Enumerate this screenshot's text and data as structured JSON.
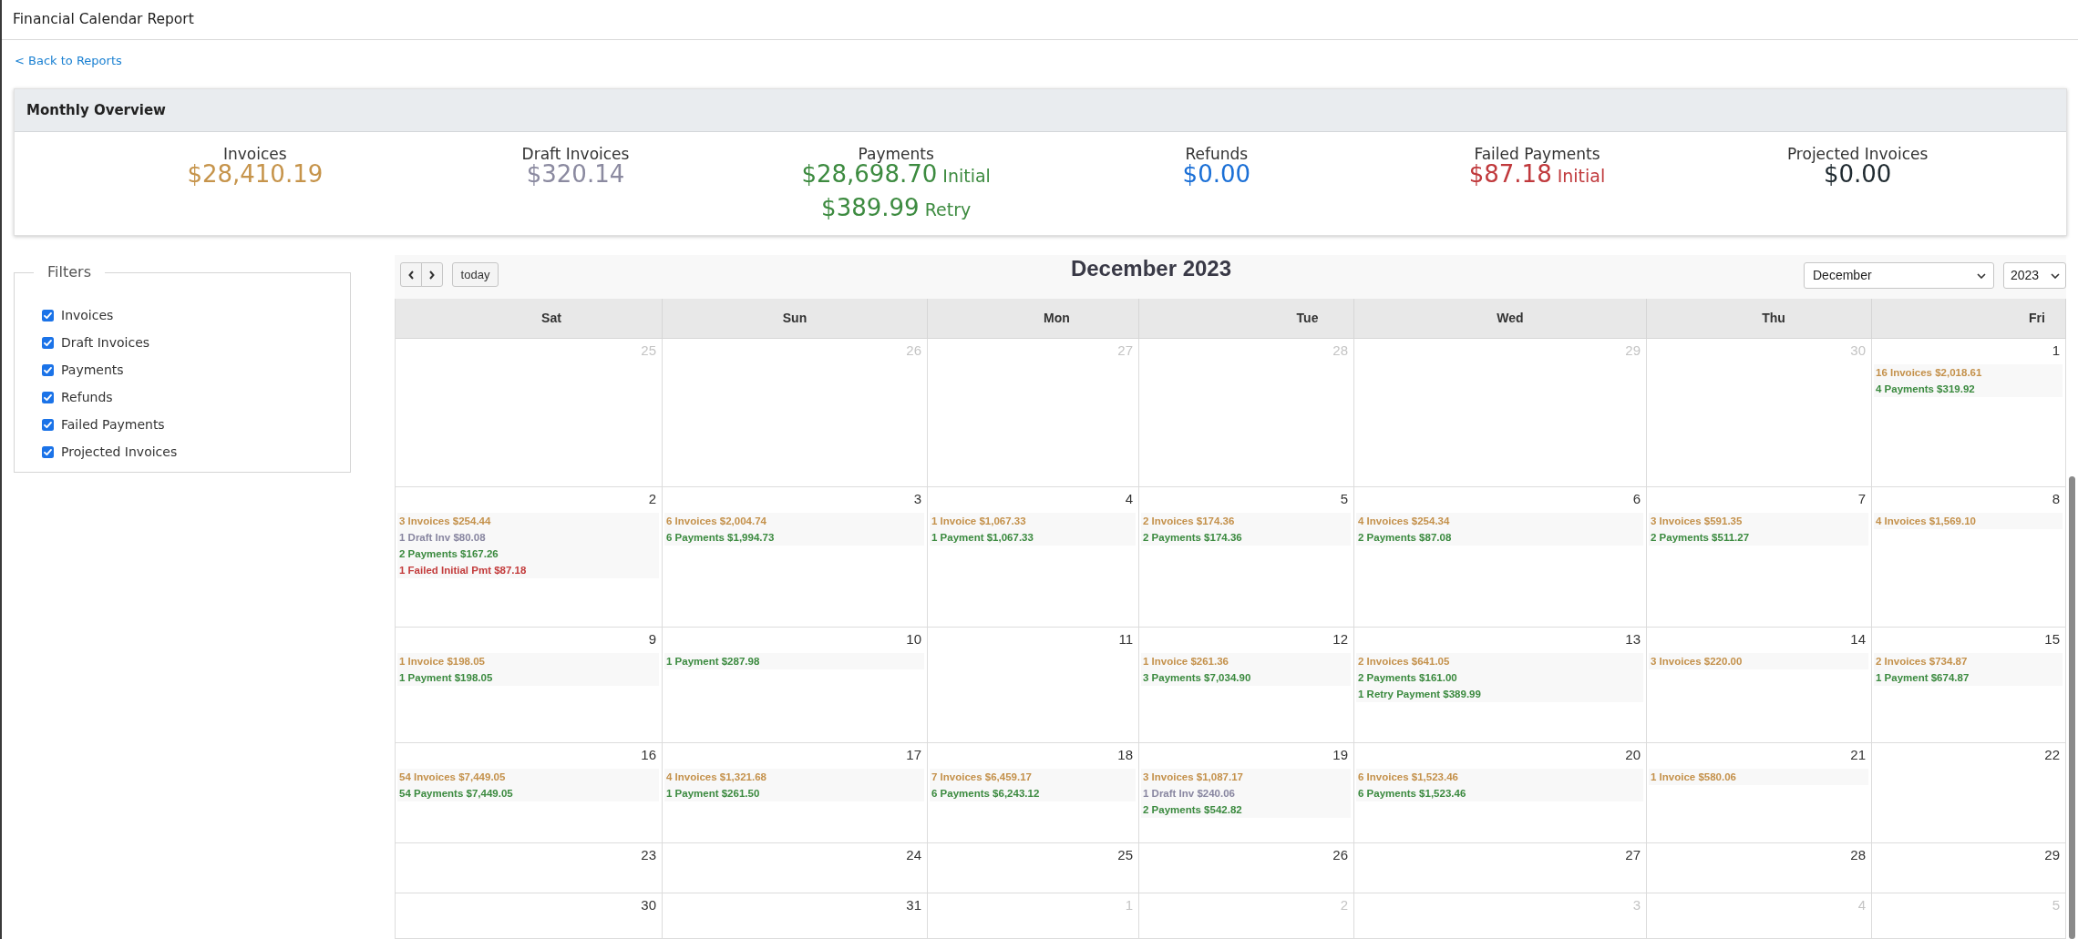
{
  "page": {
    "title": "Financial Calendar Report",
    "back_link": "< Back to Reports"
  },
  "overview": {
    "title": "Monthly Overview",
    "stats": [
      {
        "label": "Invoices",
        "color": "#c6944b",
        "amounts": [
          {
            "value": "$28,410.19"
          }
        ]
      },
      {
        "label": "Draft Invoices",
        "color": "#8b8aa0",
        "amounts": [
          {
            "value": "$320.14"
          }
        ]
      },
      {
        "label": "Payments",
        "color": "#3d8b40",
        "amounts": [
          {
            "value": "$28,698.70",
            "note": "Initial"
          },
          {
            "value": "$389.99",
            "note": "Retry"
          }
        ]
      },
      {
        "label": "Refunds",
        "color": "#1a6fd6",
        "amounts": [
          {
            "value": "$0.00"
          }
        ]
      },
      {
        "label": "Failed Payments",
        "color": "#c0393c",
        "amounts": [
          {
            "value": "$87.18",
            "note": "Initial"
          }
        ]
      },
      {
        "label": "Projected Invoices",
        "color": "#1f2a30",
        "amounts": [
          {
            "value": "$0.00"
          }
        ]
      }
    ]
  },
  "filters": {
    "legend": "Filters",
    "items": [
      {
        "label": "Invoices",
        "checked": true
      },
      {
        "label": "Draft Invoices",
        "checked": true
      },
      {
        "label": "Payments",
        "checked": true
      },
      {
        "label": "Refunds",
        "checked": true
      },
      {
        "label": "Failed Payments",
        "checked": true
      },
      {
        "label": "Projected Invoices",
        "checked": true
      }
    ]
  },
  "calendar": {
    "title": "December 2023",
    "today_button": "today",
    "month_select": "December",
    "year_select": "2023",
    "weekdays": [
      "Sat",
      "Sun",
      "Mon",
      "Tue",
      "Wed",
      "Thu",
      "Fri"
    ],
    "weeks": [
      {
        "days": [
          {
            "day": "25",
            "other_month": true
          },
          {
            "day": "26",
            "other_month": true
          },
          {
            "day": "27",
            "other_month": true
          },
          {
            "day": "28",
            "other_month": true
          },
          {
            "day": "29",
            "other_month": true
          },
          {
            "day": "30",
            "other_month": true
          },
          {
            "day": "1",
            "other_month": false,
            "events": [
              {
                "label": "16 Invoices $2,018.61",
                "color": "#c4914b"
              },
              {
                "label": "4 Payments $319.92",
                "color": "#3b8a3f"
              }
            ]
          }
        ]
      },
      {
        "days": [
          {
            "day": "2",
            "other_month": false,
            "events": [
              {
                "label": "3 Invoices $254.44",
                "color": "#c4914b"
              },
              {
                "label": "1 Draft Inv $80.08",
                "color": "#8886a0"
              },
              {
                "label": "2 Payments $167.26",
                "color": "#3b8a3f"
              },
              {
                "label": "1 Failed Initial Pmt $87.18",
                "color": "#c33b3b"
              }
            ]
          },
          {
            "day": "3",
            "other_month": false,
            "events": [
              {
                "label": "6 Invoices $2,004.74",
                "color": "#c4914b"
              },
              {
                "label": "6 Payments $1,994.73",
                "color": "#3b8a3f"
              }
            ]
          },
          {
            "day": "4",
            "other_month": false,
            "events": [
              {
                "label": "1 Invoice $1,067.33",
                "color": "#c4914b"
              },
              {
                "label": "1 Payment $1,067.33",
                "color": "#3b8a3f"
              }
            ]
          },
          {
            "day": "5",
            "other_month": false,
            "events": [
              {
                "label": "2 Invoices $174.36",
                "color": "#c4914b"
              },
              {
                "label": "2 Payments $174.36",
                "color": "#3b8a3f"
              }
            ]
          },
          {
            "day": "6",
            "other_month": false,
            "events": [
              {
                "label": "4 Invoices $254.34",
                "color": "#c4914b"
              },
              {
                "label": "2 Payments $87.08",
                "color": "#3b8a3f"
              }
            ]
          },
          {
            "day": "7",
            "other_month": false,
            "events": [
              {
                "label": "3 Invoices $591.35",
                "color": "#c4914b"
              },
              {
                "label": "2 Payments $511.27",
                "color": "#3b8a3f"
              }
            ]
          },
          {
            "day": "8",
            "other_month": false,
            "events": [
              {
                "label": "4 Invoices $1,569.10",
                "color": "#c4914b"
              }
            ]
          }
        ]
      },
      {
        "days": [
          {
            "day": "9",
            "other_month": false,
            "events": [
              {
                "label": "1 Invoice $198.05",
                "color": "#c4914b"
              },
              {
                "label": "1 Payment $198.05",
                "color": "#3b8a3f"
              }
            ]
          },
          {
            "day": "10",
            "other_month": false,
            "events": [
              {
                "label": "1 Payment $287.98",
                "color": "#3b8a3f"
              }
            ]
          },
          {
            "day": "11",
            "other_month": false
          },
          {
            "day": "12",
            "other_month": false,
            "events": [
              {
                "label": "1 Invoice $261.36",
                "color": "#c4914b"
              },
              {
                "label": "3 Payments $7,034.90",
                "color": "#3b8a3f"
              }
            ]
          },
          {
            "day": "13",
            "other_month": false,
            "events": [
              {
                "label": "2 Invoices $641.05",
                "color": "#c4914b"
              },
              {
                "label": "2 Payments $161.00",
                "color": "#3b8a3f"
              },
              {
                "label": "1 Retry Payment $389.99",
                "color": "#3b8a3f"
              }
            ]
          },
          {
            "day": "14",
            "other_month": false,
            "events": [
              {
                "label": "3 Invoices $220.00",
                "color": "#c4914b"
              }
            ]
          },
          {
            "day": "15",
            "other_month": false,
            "events": [
              {
                "label": "2 Invoices $734.87",
                "color": "#c4914b"
              },
              {
                "label": "1 Payment $674.87",
                "color": "#3b8a3f"
              }
            ]
          }
        ]
      },
      {
        "days": [
          {
            "day": "16",
            "other_month": false,
            "events": [
              {
                "label": "54 Invoices $7,449.05",
                "color": "#c4914b"
              },
              {
                "label": "54 Payments $7,449.05",
                "color": "#3b8a3f"
              }
            ]
          },
          {
            "day": "17",
            "other_month": false,
            "events": [
              {
                "label": "4 Invoices $1,321.68",
                "color": "#c4914b"
              },
              {
                "label": "1 Payment $261.50",
                "color": "#3b8a3f"
              }
            ]
          },
          {
            "day": "18",
            "other_month": false,
            "events": [
              {
                "label": "7 Invoices $6,459.17",
                "color": "#c4914b"
              },
              {
                "label": "6 Payments $6,243.12",
                "color": "#3b8a3f"
              }
            ]
          },
          {
            "day": "19",
            "other_month": false,
            "events": [
              {
                "label": "3 Invoices $1,087.17",
                "color": "#c4914b"
              },
              {
                "label": "1 Draft Inv $240.06",
                "color": "#8886a0"
              },
              {
                "label": "2 Payments $542.82",
                "color": "#3b8a3f"
              }
            ]
          },
          {
            "day": "20",
            "other_month": false,
            "events": [
              {
                "label": "6 Invoices $1,523.46",
                "color": "#c4914b"
              },
              {
                "label": "6 Payments $1,523.46",
                "color": "#3b8a3f"
              }
            ]
          },
          {
            "day": "21",
            "other_month": false,
            "events": [
              {
                "label": "1 Invoice $580.06",
                "color": "#c4914b"
              }
            ]
          },
          {
            "day": "22",
            "other_month": false
          }
        ]
      },
      {
        "days": [
          {
            "day": "23",
            "other_month": false
          },
          {
            "day": "24",
            "other_month": false
          },
          {
            "day": "25",
            "other_month": false
          },
          {
            "day": "26",
            "other_month": false
          },
          {
            "day": "27",
            "other_month": false
          },
          {
            "day": "28",
            "other_month": false
          },
          {
            "day": "29",
            "other_month": false
          }
        ]
      },
      {
        "days": [
          {
            "day": "30",
            "other_month": false
          },
          {
            "day": "31",
            "other_month": false
          },
          {
            "day": "1",
            "other_month": true
          },
          {
            "day": "2",
            "other_month": true
          },
          {
            "day": "3",
            "other_month": true
          },
          {
            "day": "4",
            "other_month": true
          },
          {
            "day": "5",
            "other_month": true
          }
        ]
      }
    ]
  }
}
